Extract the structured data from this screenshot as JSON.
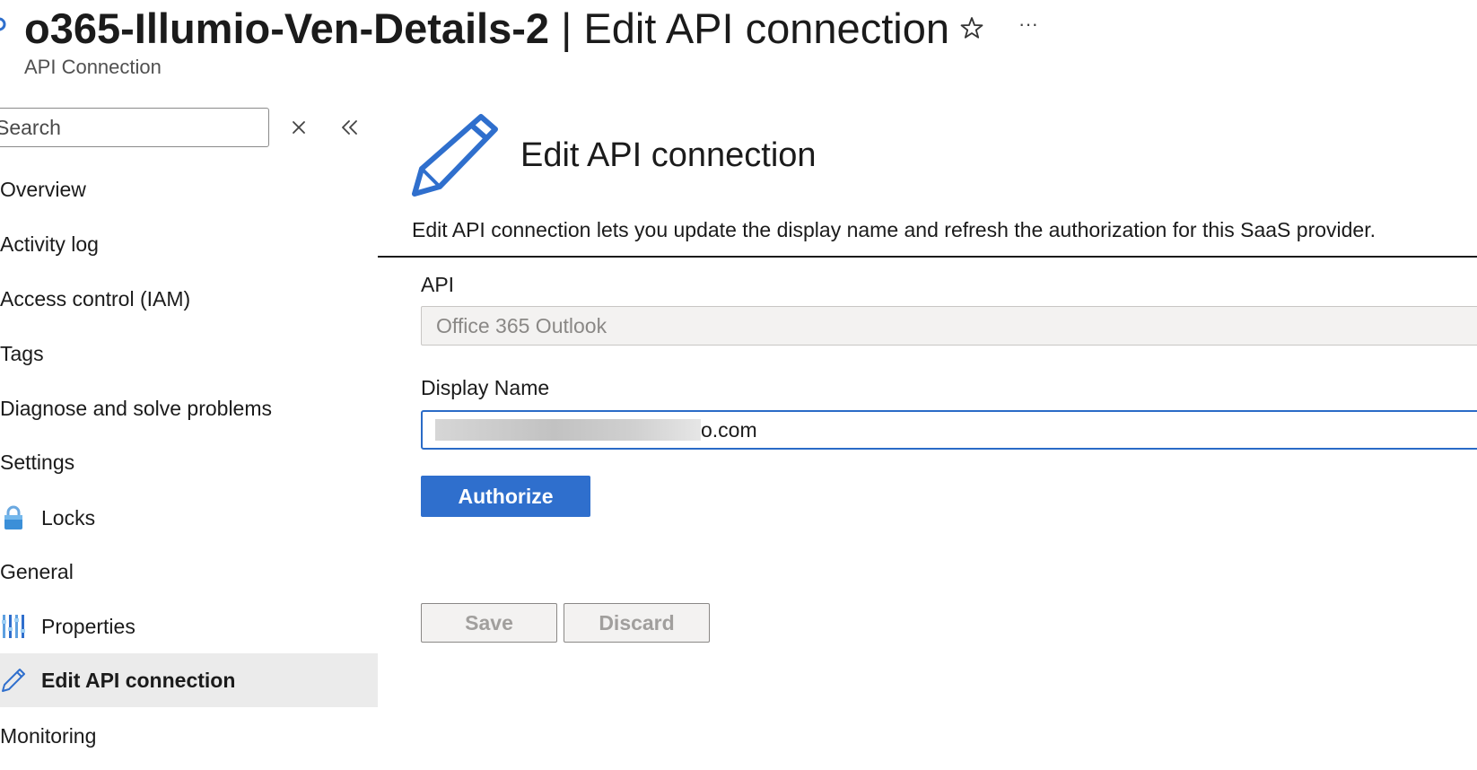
{
  "header": {
    "resource_name": "o365-Illumio-Ven-Details-2",
    "separator": " | ",
    "section_title": "Edit API connection",
    "subtitle": "API Connection",
    "star_icon": "star-icon",
    "more_icon": "more-icon"
  },
  "sidebar": {
    "search_placeholder": "Search",
    "items": [
      {
        "label": "Overview",
        "icon": null
      },
      {
        "label": "Activity log",
        "icon": null
      },
      {
        "label": "Access control (IAM)",
        "icon": null
      },
      {
        "label": "Tags",
        "icon": null
      },
      {
        "label": "Diagnose and solve problems",
        "icon": null
      },
      {
        "label": "Settings",
        "icon": null,
        "group": true
      },
      {
        "label": "Locks",
        "icon": "lock-icon"
      },
      {
        "label": "General",
        "icon": null,
        "group": true
      },
      {
        "label": "Properties",
        "icon": "properties-icon"
      },
      {
        "label": "Edit API connection",
        "icon": "pencil-icon",
        "selected": true
      },
      {
        "label": "Monitoring",
        "icon": null,
        "group": true
      }
    ]
  },
  "main": {
    "title": "Edit API connection",
    "description": "Edit API connection lets you update the display name and refresh the authorization for this SaaS provider.",
    "api_label": "API",
    "api_value": "Office 365 Outlook",
    "display_name_label": "Display Name",
    "display_name_suffix": "o.com",
    "authorize_label": "Authorize",
    "save_label": "Save",
    "discard_label": "Discard"
  },
  "colors": {
    "accent": "#2f6fcd",
    "input_focus": "#2a6bc7",
    "selected_bg": "#ebebeb"
  }
}
